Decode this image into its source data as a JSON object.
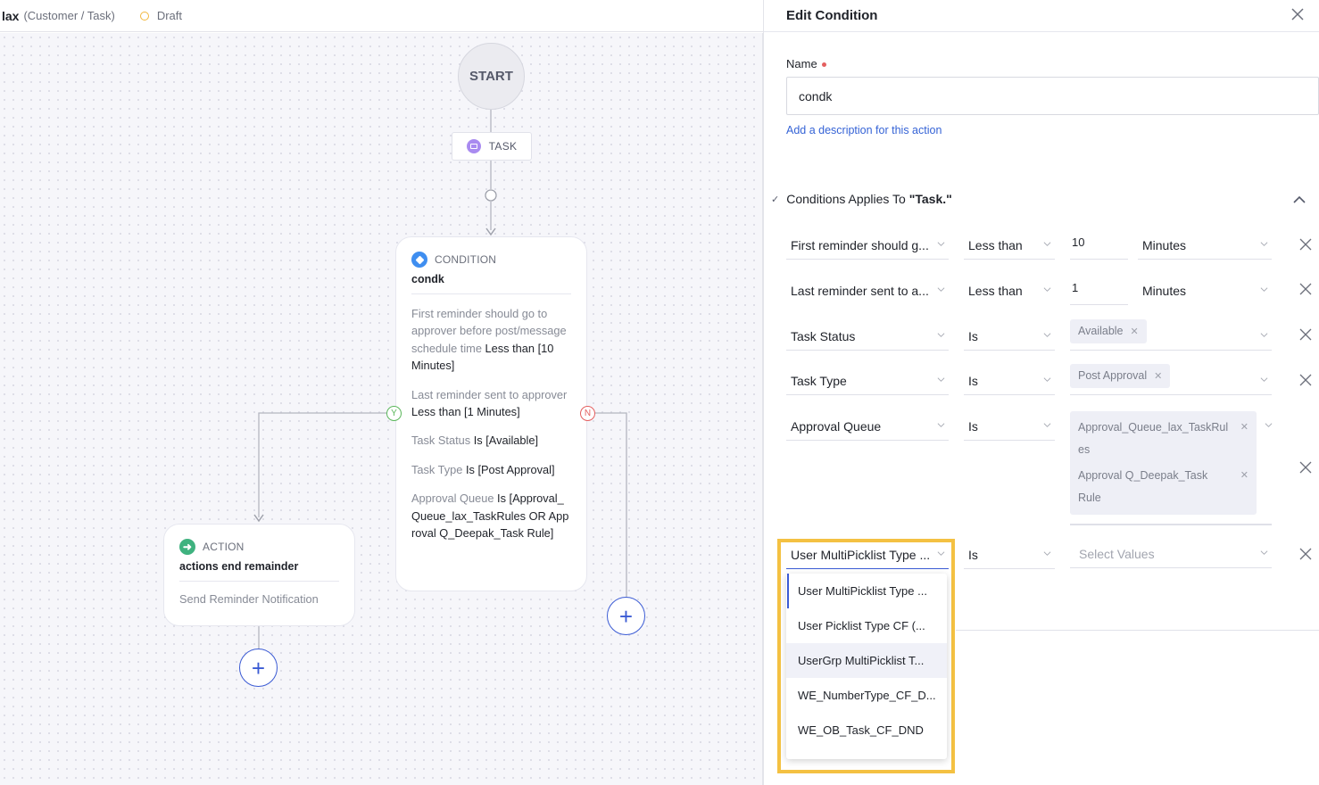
{
  "header": {
    "name": "lax",
    "context": "(Customer / Task)",
    "status": "Draft",
    "status_color": "#f2b73d"
  },
  "canvas": {
    "start_label": "START",
    "task_node": {
      "label": "TASK",
      "icon": "chat-bubble-icon"
    },
    "branch_yes": "Y",
    "branch_no": "N",
    "condition_card": {
      "type": "CONDITION",
      "title": "condk",
      "lines": [
        {
          "field": "First reminder should go to approver before post/message schedule time",
          "value": "Less than [10 Minutes]"
        },
        {
          "field": "Last reminder sent to approver",
          "value": "Less than [1 Minutes]"
        },
        {
          "field": "Task Status",
          "value": "Is [Available]"
        },
        {
          "field": "Task Type",
          "value": "Is [Post Approval]"
        },
        {
          "field": "Approval Queue",
          "value": "Is [Approval_Queue_lax_TaskRules OR Approval Q_Deepak_Task Rule]"
        }
      ]
    },
    "action_card": {
      "type": "ACTION",
      "title": "actions end remainder",
      "subtitle": "Send Reminder Notification"
    },
    "add_step_symbol": "+"
  },
  "panel": {
    "title": "Edit Condition",
    "name_label": "Name",
    "name_value": "condk",
    "add_description": "Add a description for this action",
    "conditions_prefix": "Conditions Applies To ",
    "conditions_entity": "\"Task.\"",
    "rows": [
      {
        "field": "First reminder should g...",
        "operator": "Less than",
        "value": "10",
        "unit": "Minutes"
      },
      {
        "field": "Last reminder sent to a...",
        "operator": "Less than",
        "value": "1",
        "unit": "Minutes"
      },
      {
        "field": "Task Status",
        "operator": "Is",
        "chips": [
          "Available"
        ]
      },
      {
        "field": "Task Type",
        "operator": "Is",
        "chips": [
          "Post Approval"
        ]
      },
      {
        "field": "Approval Queue",
        "operator": "Is",
        "chips": [
          "Approval_Queue_lax_TaskRul es",
          "Approval Q_Deepak_Task Rule"
        ]
      },
      {
        "field": "User MultiPicklist Type ...",
        "operator": "Is",
        "placeholder": "Select Values"
      }
    ],
    "dropdown_options": [
      "User MultiPicklist Type ...",
      "User Picklist Type CF (...",
      "UserGrp MultiPicklist T...",
      "WE_NumberType_CF_D...",
      "WE_OB_Task_CF_DND"
    ],
    "dropdown_selected_index": 0,
    "dropdown_hover_index": 2,
    "highlight_color": "#f4c142",
    "accent_color": "#3b5bd4"
  }
}
